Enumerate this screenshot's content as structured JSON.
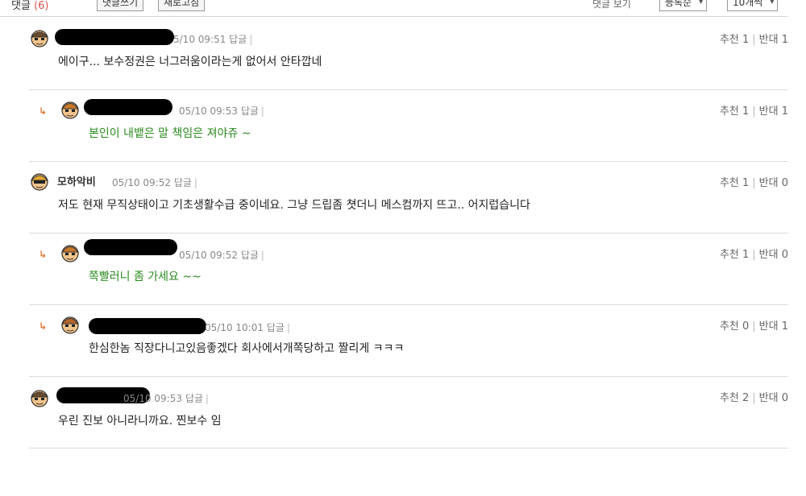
{
  "toolbar": {
    "label": "댓글",
    "count": "(6)",
    "write_label": "댓글쓰기",
    "refresh_label": "새로고침",
    "sort_label": "댓글 보기",
    "sort_value": "등록순",
    "page_value": "10개씩"
  },
  "comments": [
    {
      "nick": "",
      "time": "5/10 09:51",
      "reply": "답글",
      "text": "에이구... 보수정권은 너그러움이라는게 없어서 안타깝네",
      "likes_label": "추천 1",
      "dislikes_label": "반대 1",
      "green": false
    },
    {
      "nick": "",
      "time": "05/10 09:53",
      "reply": "답글",
      "text": "본인이 내뱉은 말 책임은 져야쥬 ~",
      "likes_label": "추천 1",
      "dislikes_label": "반대 1",
      "green": true
    },
    {
      "nick": "모하악비",
      "time": "05/10 09:52",
      "reply": "답글",
      "text": "저도 현재 무직상태이고 기초생활수급 중이네요. 그냥 드립좀 쳣더니 메스컴까지 뜨고.. 어지럽습니다",
      "likes_label": "추천 1",
      "dislikes_label": "반대 0",
      "green": false
    },
    {
      "nick": "",
      "time": "05/10 09:52",
      "reply": "답글",
      "text": "쪽빨러니 좀 가세요 ~~",
      "likes_label": "추천 1",
      "dislikes_label": "반대 0",
      "green": true
    },
    {
      "nick": "",
      "time": "05/10 10:01",
      "reply": "답글",
      "text": "한심한놈 직장다니고있음좋겠다 회사에서개쪽당하고 짤리게 ㅋㅋㅋ",
      "likes_label": "추천 0",
      "dislikes_label": "반대 1",
      "green": false
    },
    {
      "nick": "",
      "time": "05/10 09:53",
      "reply": "답글",
      "text": "우린 진보 아니라니까요. 찐보수 임",
      "likes_label": "추천 2",
      "dislikes_label": "반대 0",
      "green": false
    }
  ]
}
